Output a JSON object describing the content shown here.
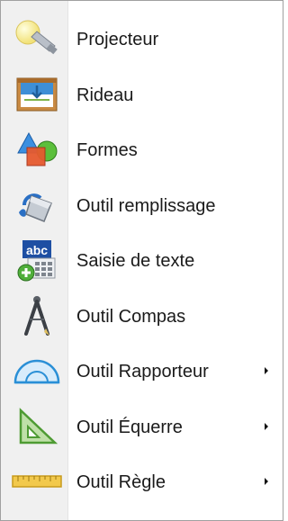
{
  "menu": {
    "items": [
      {
        "label": "Projecteur",
        "icon": "spotlight-icon",
        "submenu": false
      },
      {
        "label": "Rideau",
        "icon": "curtain-icon",
        "submenu": false
      },
      {
        "label": "Formes",
        "icon": "shapes-icon",
        "submenu": false
      },
      {
        "label": "Outil remplissage",
        "icon": "paint-bucket-icon",
        "submenu": false
      },
      {
        "label": "Saisie de texte",
        "icon": "text-input-icon",
        "submenu": false
      },
      {
        "label": "Outil Compas",
        "icon": "compass-icon",
        "submenu": true
      },
      {
        "label": "Outil Rapporteur",
        "icon": "protractor-icon",
        "submenu": true
      },
      {
        "label": "Outil Équerre",
        "icon": "set-square-icon",
        "submenu": true
      },
      {
        "label": "Outil Règle",
        "icon": "ruler-icon",
        "submenu": true
      }
    ]
  }
}
